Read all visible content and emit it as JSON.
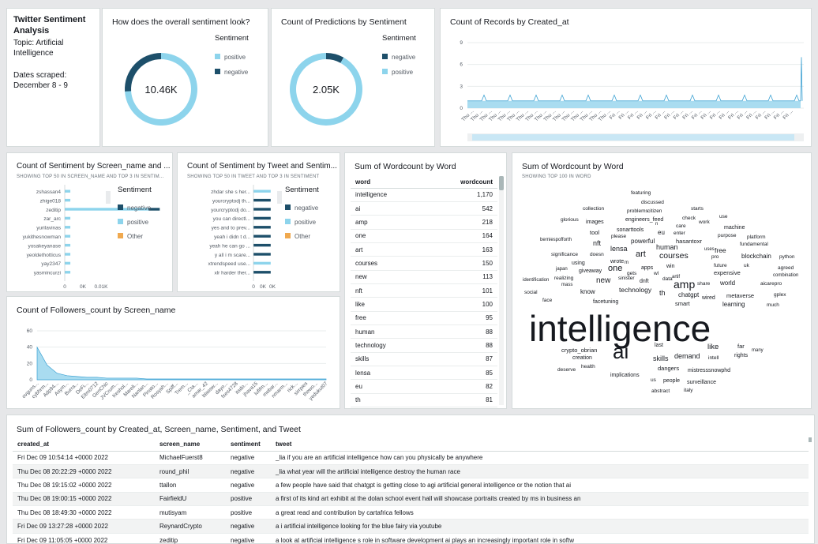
{
  "title_card": {
    "title": "Twitter Sentiment Analysis",
    "topic": "Topic: Artificial Intelligence",
    "dates_label": "Dates scraped:",
    "dates_value": "December 8 - 9"
  },
  "colors": {
    "positive": "#8dd4ec",
    "negative": "#1d4f6a",
    "other": "#f0a94f",
    "area": "#a9dcf0",
    "trend": "#3aa0d2"
  },
  "chart_data": [
    {
      "id": "donut1",
      "type": "pie",
      "title": "How does the overall sentiment look?",
      "legend_title": "Sentiment",
      "center_label": "10.46K",
      "slices": [
        {
          "name": "positive",
          "value": 74
        },
        {
          "name": "negative",
          "value": 26
        }
      ]
    },
    {
      "id": "donut2",
      "type": "pie",
      "title": "Count of Predictions by Sentiment",
      "legend_title": "Sentiment",
      "center_label": "2.05K",
      "slices": [
        {
          "name": "negative",
          "value": 8
        },
        {
          "name": "positive",
          "value": 92
        }
      ]
    },
    {
      "id": "records",
      "type": "area",
      "title": "Count of Records by Created_at",
      "yticks": [
        0,
        3,
        6,
        9
      ],
      "ylim": [
        0,
        9
      ],
      "x_tick_label_a": "Thu ...",
      "x_tick_label_b": "Fri ...",
      "x_tick_labels_count_a": 16,
      "x_tick_labels_count_b": 20,
      "baseline_value": 1,
      "last_value": 7
    },
    {
      "id": "sent_screen",
      "type": "bar",
      "title": "Count of Sentiment by Screen_name and ...",
      "subtitle": "SHOWING TOP 50 IN SCREEN_NAME AND TOP 3 IN SENTIM...",
      "legend_title": "Sentiment",
      "legend": [
        "negative",
        "positive",
        "Other"
      ],
      "categories": [
        "zshassan4",
        "zhige018",
        "zeditip",
        "zar_arc",
        "yurilavinas",
        "yukithesnowman",
        "yosakeyanase",
        "yeoldethotticus",
        "yay2347",
        "yasmincurzi"
      ],
      "series": [
        {
          "name": "positive",
          "values": [
            0.002,
            0.002,
            0.03,
            0.002,
            0.002,
            0.002,
            0.002,
            0.002,
            0.002,
            0.002
          ]
        },
        {
          "name": "negative",
          "values": [
            0,
            0,
            0.004,
            0,
            0,
            0,
            0,
            0,
            0,
            0
          ]
        }
      ],
      "xticks": [
        "0",
        "0K",
        "0.01K"
      ],
      "xlim": [
        0,
        0.013
      ]
    },
    {
      "id": "sent_tweet",
      "type": "bar",
      "title": "Count of Sentiment by Tweet and Sentim...",
      "subtitle": "SHOWING TOP 50 IN TWEET AND TOP 3 IN SENTIMENT",
      "legend_title": "Sentiment",
      "legend": [
        "negative",
        "positive",
        "Other"
      ],
      "categories": [
        "zhdar she s her...",
        "yourcryptodj th...",
        "yourcryptodj do...",
        "you can directl...",
        "yes and to prev...",
        "yeah i didn t d...",
        "yeah he can go ...",
        "y all i m scare...",
        "xtrendspeed use...",
        "xlr harder ther..."
      ],
      "series": [
        {
          "name": "negative",
          "values": [
            0,
            1,
            1,
            1,
            1,
            1,
            1,
            1,
            0,
            1
          ]
        },
        {
          "name": "positive",
          "values": [
            1,
            0,
            0,
            0,
            0,
            0,
            0,
            0,
            1,
            0
          ]
        }
      ],
      "xticks": [
        "0",
        "0K",
        "0K"
      ],
      "xlim": [
        0,
        1.1
      ]
    },
    {
      "id": "followers",
      "type": "area",
      "title": "Count of Followers_count by Screen_name",
      "yticks": [
        0,
        20,
        40,
        60
      ],
      "ylim": [
        0,
        60
      ],
      "x_labels": [
        "ovguns...",
        "cybhrm...",
        "Adp94...",
        "Asym...",
        "Burra...",
        "DeFi...",
        "Eltm0712",
        "GenChic",
        "JVCrum...",
        "Keshol...",
        "Mareli...",
        "Nanlan...",
        "Pinato...",
        "Rosyah...",
        "Spiff...",
        "Trem...",
        "_Cta...",
        "amar_42",
        "blassw...",
        "dayo...",
        "fxes4728",
        "itsdo...",
        "jhava15",
        "lufifm...",
        "mebar...",
        "nmarm...",
        "rick...",
        "sirrpies",
        "thewo...",
        "yedukut07"
      ],
      "values": [
        40,
        18,
        8,
        5,
        4,
        3,
        3,
        2,
        2,
        2,
        2,
        1,
        1,
        1,
        1,
        1,
        1,
        1,
        1,
        1,
        1,
        1,
        1,
        1,
        1,
        1,
        1,
        1,
        1,
        1
      ]
    },
    {
      "id": "wordcount",
      "type": "table",
      "title": "Sum of Wordcount by Word",
      "columns": [
        "word",
        "wordcount"
      ],
      "rows": [
        [
          "intelligence",
          "1,170"
        ],
        [
          "ai",
          "542"
        ],
        [
          "amp",
          "218"
        ],
        [
          "one",
          "164"
        ],
        [
          "art",
          "163"
        ],
        [
          "courses",
          "150"
        ],
        [
          "new",
          "113"
        ],
        [
          "nft",
          "101"
        ],
        [
          "like",
          "100"
        ],
        [
          "free",
          "95"
        ],
        [
          "human",
          "88"
        ],
        [
          "technology",
          "88"
        ],
        [
          "skills",
          "87"
        ],
        [
          "lensa",
          "85"
        ],
        [
          "eu",
          "82"
        ],
        [
          "th",
          "81"
        ]
      ]
    },
    {
      "id": "wordcloud",
      "type": "wordcloud",
      "title": "Sum of Wordcount by Word",
      "subtitle": "SHOWING TOP 100 IN WORD",
      "words": [
        [
          "featuring",
          150,
          45,
          6.5
        ],
        [
          "discussed",
          163,
          57,
          6.5
        ],
        [
          "collection",
          89,
          65,
          6.5
        ],
        [
          "starts",
          226,
          65,
          6.5
        ],
        [
          "problems",
          145,
          68,
          6.5
        ],
        [
          "citizen",
          171,
          68,
          6.5
        ],
        [
          "use",
          262,
          75,
          6.5
        ],
        [
          "glorious",
          61,
          79,
          6.5
        ],
        [
          "images",
          93,
          82,
          7
        ],
        [
          "engineers_feed",
          143,
          79,
          7
        ],
        [
          "check",
          215,
          77,
          6.5
        ],
        [
          "work",
          236,
          82,
          6.5
        ],
        [
          "n",
          181,
          84,
          6
        ],
        [
          "care",
          207,
          87,
          6.5
        ],
        [
          "machine",
          268,
          89,
          7
        ],
        [
          "sonarttools",
          132,
          92,
          7
        ],
        [
          "tool",
          98,
          96,
          7.5
        ],
        [
          "please",
          125,
          100,
          6.5
        ],
        [
          "eu",
          184,
          96,
          8
        ],
        [
          "enter",
          204,
          96,
          6.5
        ],
        [
          "purpose",
          260,
          99,
          6.5
        ],
        [
          "platform",
          297,
          101,
          6.5
        ],
        [
          "berniespofforth",
          35,
          104,
          6
        ],
        [
          "nft",
          102,
          110,
          9
        ],
        [
          "powerful",
          150,
          107,
          8
        ],
        [
          "hasantoxr",
          207,
          107,
          7.5
        ],
        [
          "fundamental",
          288,
          110,
          6.5
        ],
        [
          "free",
          256,
          119,
          8.5
        ],
        [
          "human",
          182,
          115,
          9
        ],
        [
          "lensa",
          124,
          117,
          9
        ],
        [
          "uses",
          243,
          116,
          6
        ],
        [
          "courses",
          186,
          126,
          10.5
        ],
        [
          "art",
          156,
          124,
          11
        ],
        [
          "blockchain",
          290,
          126,
          8
        ],
        [
          "significance",
          49,
          123,
          6.5
        ],
        [
          "doesn",
          98,
          123,
          6.5
        ],
        [
          "pro",
          252,
          126,
          6.5
        ],
        [
          "python",
          338,
          126,
          6.5
        ],
        [
          "wrote",
          124,
          132,
          7
        ],
        [
          "m",
          142,
          133,
          6
        ],
        [
          "apps",
          163,
          140,
          7
        ],
        [
          "win",
          195,
          138,
          7
        ],
        [
          "future",
          255,
          137,
          6.5
        ],
        [
          "uk",
          293,
          137,
          6.5
        ],
        [
          "agreed",
          336,
          140,
          6.5
        ],
        [
          "one",
          121,
          142,
          11
        ],
        [
          "using",
          75,
          134,
          7
        ],
        [
          "japan",
          55,
          141,
          6
        ],
        [
          "giveaway",
          84,
          144,
          7
        ],
        [
          "gets",
          145,
          147,
          6.5
        ],
        [
          "wl",
          179,
          147,
          6.5
        ],
        [
          "artif",
          202,
          151,
          6
        ],
        [
          "expensive",
          255,
          147,
          7.5
        ],
        [
          "combination",
          330,
          149,
          6
        ],
        [
          "identification",
          13,
          155,
          6
        ],
        [
          "realizing",
          53,
          153,
          6.5
        ],
        [
          "new",
          106,
          157,
          10
        ],
        [
          "sinister",
          134,
          153,
          6.5
        ],
        [
          "dnft",
          161,
          157,
          7
        ],
        [
          "data",
          190,
          154,
          6.5
        ],
        [
          "amp",
          204,
          164,
          14
        ],
        [
          "share",
          234,
          160,
          6.5
        ],
        [
          "world",
          263,
          160,
          8
        ],
        [
          "aicarepro",
          314,
          160,
          6.5
        ],
        [
          "mass",
          62,
          161,
          6
        ],
        [
          "technology",
          135,
          169,
          8.5
        ],
        [
          "know",
          86,
          171,
          8
        ],
        [
          "social",
          15,
          171,
          6.5
        ],
        [
          "th",
          186,
          173,
          9
        ],
        [
          "chatgpt",
          210,
          175,
          8
        ],
        [
          "wired",
          240,
          178,
          7
        ],
        [
          "metaverse",
          271,
          176,
          7.5
        ],
        [
          "gplex",
          331,
          174,
          6.5
        ],
        [
          "facetuning",
          102,
          183,
          7
        ],
        [
          "face",
          38,
          181,
          6.5
        ],
        [
          "smart",
          206,
          186,
          7.5
        ],
        [
          "learning",
          266,
          187,
          8
        ],
        [
          "much",
          322,
          187,
          6.5
        ],
        [
          "intelligence",
          21,
          231,
          46
        ],
        [
          "ai",
          127,
          253,
          26
        ],
        [
          "last",
          180,
          238,
          7
        ],
        [
          "like",
          247,
          241,
          9.5
        ],
        [
          "far",
          285,
          240,
          7.5
        ],
        [
          "many",
          303,
          244,
          6
        ],
        [
          "crypto_obrian",
          62,
          245,
          7.5
        ],
        [
          "creation",
          76,
          254,
          7
        ],
        [
          "skills",
          178,
          256,
          9
        ],
        [
          "demand",
          205,
          253,
          9
        ],
        [
          "intell",
          248,
          254,
          6.5
        ],
        [
          "rights",
          281,
          251,
          7
        ],
        [
          "health",
          87,
          265,
          6.5
        ],
        [
          "deserve",
          57,
          269,
          6.5
        ],
        [
          "dangers",
          184,
          268,
          7.5
        ],
        [
          "mistresssnowphd",
          222,
          270,
          7
        ],
        [
          "implications",
          124,
          276,
          7
        ],
        [
          "us",
          175,
          282,
          6.5
        ],
        [
          "people",
          191,
          283,
          7
        ],
        [
          "surveillance",
          221,
          285,
          7
        ],
        [
          "abstract",
          176,
          296,
          6.5
        ],
        [
          "italy",
          217,
          295,
          6.5
        ]
      ]
    }
  ],
  "bottom_table": {
    "title": "Sum of Followers_count by Created_at, Screen_name, Sentiment, and Tweet",
    "columns": [
      "created_at",
      "screen_name",
      "sentiment",
      "tweet"
    ],
    "rows": [
      [
        "Fri Dec 09 10:54:14 +0000 2022",
        "MichaelFuerst8",
        "negative",
        "_lia if you are an artificial intelligence how can you physically be anywhere"
      ],
      [
        "Thu Dec 08 20:22:29 +0000 2022",
        "round_phil",
        "negative",
        "_lia what year will the artificial intelligence destroy the human race"
      ],
      [
        "Thu Dec 08 19:15:02 +0000 2022",
        "ttallon",
        "negative",
        "a few people have said that chatgpt is getting close to agi artificial general intelligence or the notion that ai"
      ],
      [
        "Thu Dec 08 19:00:15 +0000 2022",
        "FairfieldU",
        "positive",
        "a first of its kind art exhibit at the dolan school event hall will showcase portraits created by ms in business an"
      ],
      [
        "Thu Dec 08 18:49:30 +0000 2022",
        "mutisyam",
        "positive",
        "a great read and contribution by cartafrica fellows"
      ],
      [
        "Fri Dec 09 13:27:28 +0000 2022",
        "ReynardCrypto",
        "negative",
        "a i artificial intelligence looking for the blue fairy via youtube"
      ],
      [
        "Fri Dec 09 11:05:05 +0000 2022",
        "zeditip",
        "negative",
        "a look at artificial intelligence s role in software development ai plays an increasingly important role in softw"
      ]
    ]
  }
}
